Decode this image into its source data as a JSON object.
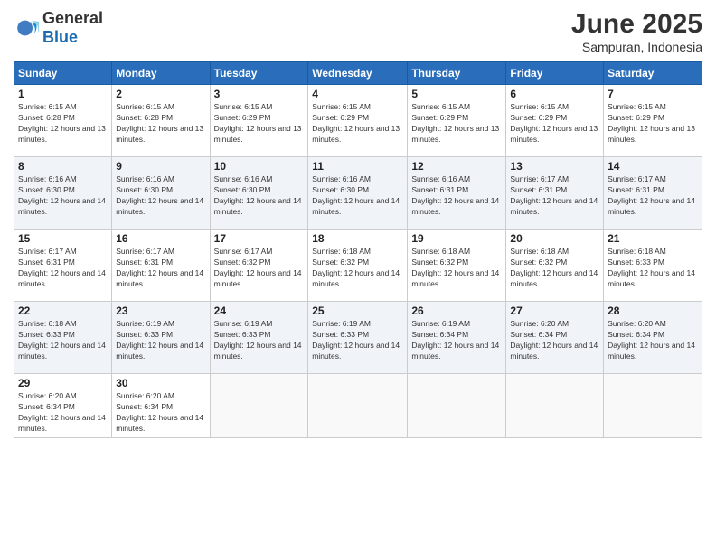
{
  "header": {
    "logo_general": "General",
    "logo_blue": "Blue",
    "title": "June 2025",
    "location": "Sampuran, Indonesia"
  },
  "weekdays": [
    "Sunday",
    "Monday",
    "Tuesday",
    "Wednesday",
    "Thursday",
    "Friday",
    "Saturday"
  ],
  "weeks": [
    [
      {
        "day": "1",
        "sunrise": "6:15 AM",
        "sunset": "6:28 PM",
        "daylight": "12 hours and 13 minutes."
      },
      {
        "day": "2",
        "sunrise": "6:15 AM",
        "sunset": "6:28 PM",
        "daylight": "12 hours and 13 minutes."
      },
      {
        "day": "3",
        "sunrise": "6:15 AM",
        "sunset": "6:29 PM",
        "daylight": "12 hours and 13 minutes."
      },
      {
        "day": "4",
        "sunrise": "6:15 AM",
        "sunset": "6:29 PM",
        "daylight": "12 hours and 13 minutes."
      },
      {
        "day": "5",
        "sunrise": "6:15 AM",
        "sunset": "6:29 PM",
        "daylight": "12 hours and 13 minutes."
      },
      {
        "day": "6",
        "sunrise": "6:15 AM",
        "sunset": "6:29 PM",
        "daylight": "12 hours and 13 minutes."
      },
      {
        "day": "7",
        "sunrise": "6:15 AM",
        "sunset": "6:29 PM",
        "daylight": "12 hours and 13 minutes."
      }
    ],
    [
      {
        "day": "8",
        "sunrise": "6:16 AM",
        "sunset": "6:30 PM",
        "daylight": "12 hours and 14 minutes."
      },
      {
        "day": "9",
        "sunrise": "6:16 AM",
        "sunset": "6:30 PM",
        "daylight": "12 hours and 14 minutes."
      },
      {
        "day": "10",
        "sunrise": "6:16 AM",
        "sunset": "6:30 PM",
        "daylight": "12 hours and 14 minutes."
      },
      {
        "day": "11",
        "sunrise": "6:16 AM",
        "sunset": "6:30 PM",
        "daylight": "12 hours and 14 minutes."
      },
      {
        "day": "12",
        "sunrise": "6:16 AM",
        "sunset": "6:31 PM",
        "daylight": "12 hours and 14 minutes."
      },
      {
        "day": "13",
        "sunrise": "6:17 AM",
        "sunset": "6:31 PM",
        "daylight": "12 hours and 14 minutes."
      },
      {
        "day": "14",
        "sunrise": "6:17 AM",
        "sunset": "6:31 PM",
        "daylight": "12 hours and 14 minutes."
      }
    ],
    [
      {
        "day": "15",
        "sunrise": "6:17 AM",
        "sunset": "6:31 PM",
        "daylight": "12 hours and 14 minutes."
      },
      {
        "day": "16",
        "sunrise": "6:17 AM",
        "sunset": "6:31 PM",
        "daylight": "12 hours and 14 minutes."
      },
      {
        "day": "17",
        "sunrise": "6:17 AM",
        "sunset": "6:32 PM",
        "daylight": "12 hours and 14 minutes."
      },
      {
        "day": "18",
        "sunrise": "6:18 AM",
        "sunset": "6:32 PM",
        "daylight": "12 hours and 14 minutes."
      },
      {
        "day": "19",
        "sunrise": "6:18 AM",
        "sunset": "6:32 PM",
        "daylight": "12 hours and 14 minutes."
      },
      {
        "day": "20",
        "sunrise": "6:18 AM",
        "sunset": "6:32 PM",
        "daylight": "12 hours and 14 minutes."
      },
      {
        "day": "21",
        "sunrise": "6:18 AM",
        "sunset": "6:33 PM",
        "daylight": "12 hours and 14 minutes."
      }
    ],
    [
      {
        "day": "22",
        "sunrise": "6:18 AM",
        "sunset": "6:33 PM",
        "daylight": "12 hours and 14 minutes."
      },
      {
        "day": "23",
        "sunrise": "6:19 AM",
        "sunset": "6:33 PM",
        "daylight": "12 hours and 14 minutes."
      },
      {
        "day": "24",
        "sunrise": "6:19 AM",
        "sunset": "6:33 PM",
        "daylight": "12 hours and 14 minutes."
      },
      {
        "day": "25",
        "sunrise": "6:19 AM",
        "sunset": "6:33 PM",
        "daylight": "12 hours and 14 minutes."
      },
      {
        "day": "26",
        "sunrise": "6:19 AM",
        "sunset": "6:34 PM",
        "daylight": "12 hours and 14 minutes."
      },
      {
        "day": "27",
        "sunrise": "6:20 AM",
        "sunset": "6:34 PM",
        "daylight": "12 hours and 14 minutes."
      },
      {
        "day": "28",
        "sunrise": "6:20 AM",
        "sunset": "6:34 PM",
        "daylight": "12 hours and 14 minutes."
      }
    ],
    [
      {
        "day": "29",
        "sunrise": "6:20 AM",
        "sunset": "6:34 PM",
        "daylight": "12 hours and 14 minutes."
      },
      {
        "day": "30",
        "sunrise": "6:20 AM",
        "sunset": "6:34 PM",
        "daylight": "12 hours and 14 minutes."
      },
      null,
      null,
      null,
      null,
      null
    ]
  ]
}
